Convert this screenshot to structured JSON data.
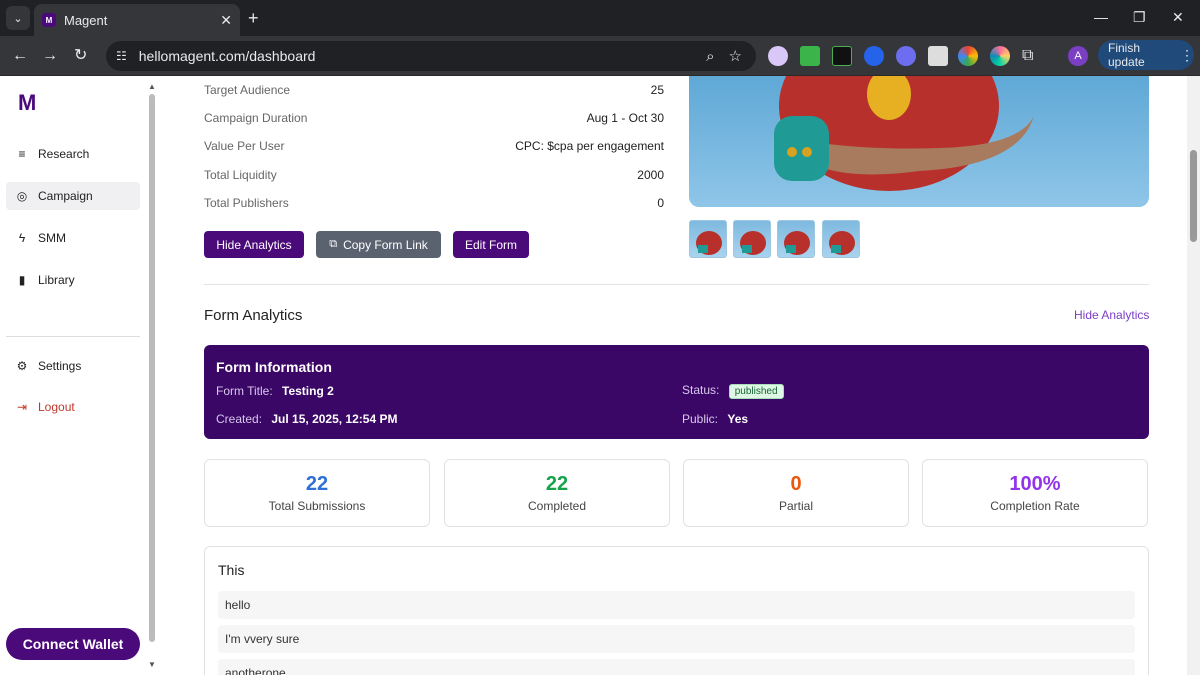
{
  "browser": {
    "tab_title": "Magent",
    "favicon_letter": "M",
    "url": "hellomagent.com/dashboard",
    "profile_initial": "A",
    "finish_update": "Finish update"
  },
  "sidebar": {
    "logo": "M",
    "items": [
      {
        "label": "Research",
        "icon": "research-icon"
      },
      {
        "label": "Campaign",
        "icon": "campaign-icon"
      },
      {
        "label": "SMM",
        "icon": "bolt-icon"
      },
      {
        "label": "Library",
        "icon": "bookmark-icon"
      }
    ],
    "settings": "Settings",
    "logout": "Logout",
    "connect_wallet": "Connect Wallet"
  },
  "campaign_details": [
    {
      "label": "Target Audience",
      "value": "25"
    },
    {
      "label": "Campaign Duration",
      "value": "Aug 1 - Oct 30"
    },
    {
      "label": "Value Per User",
      "value": "CPC: $cpa per engagement"
    },
    {
      "label": "Total Liquidity",
      "value": "2000"
    },
    {
      "label": "Total Publishers",
      "value": "0"
    }
  ],
  "actions": {
    "hide_analytics": "Hide Analytics",
    "copy_form_link": "Copy Form Link",
    "edit_form": "Edit Form"
  },
  "analytics": {
    "title": "Form Analytics",
    "hide_link": "Hide Analytics",
    "form_info": {
      "heading": "Form Information",
      "form_title_label": "Form Title:",
      "form_title": "Testing 2",
      "status_label": "Status:",
      "status": "published",
      "created_label": "Created:",
      "created": "Jul 15, 2025, 12:54 PM",
      "public_label": "Public:",
      "public": "Yes"
    },
    "stats": [
      {
        "value": "22",
        "label": "Total Submissions",
        "color": "#2f6fd6"
      },
      {
        "value": "22",
        "label": "Completed",
        "color": "#16a34a"
      },
      {
        "value": "0",
        "label": "Partial",
        "color": "#ea580c"
      },
      {
        "value": "100%",
        "label": "Completion Rate",
        "color": "#9333ea"
      }
    ],
    "responses": {
      "question": "This",
      "answers": [
        "hello",
        "I'm vvery sure",
        "anotherone"
      ]
    }
  },
  "colors": {
    "brand": "#4b0a7a",
    "form_info_bg": "#3b0766",
    "link": "#7b3fc4"
  }
}
